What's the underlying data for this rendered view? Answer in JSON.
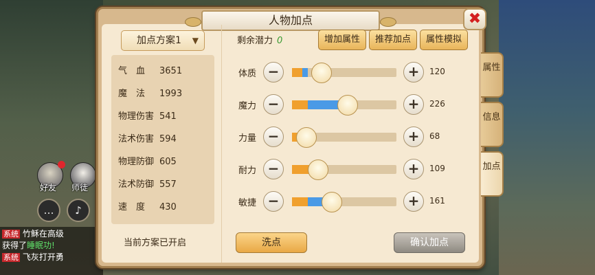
{
  "window": {
    "title": "人物加点"
  },
  "close": {
    "label": "✖"
  },
  "scheme": {
    "selected": "加点方案1",
    "status": "当前方案已开启"
  },
  "stats": [
    {
      "name": "气　血",
      "value": "3651"
    },
    {
      "name": "魔　法",
      "value": "1993"
    },
    {
      "name": "物理伤害",
      "value": "541"
    },
    {
      "name": "法术伤害",
      "value": "594"
    },
    {
      "name": "物理防御",
      "value": "605"
    },
    {
      "name": "法术防御",
      "value": "557"
    },
    {
      "name": "速　度",
      "value": "430"
    }
  ],
  "potential": {
    "label": "剩余潜力",
    "value": "0"
  },
  "top_buttons": [
    "增加属性",
    "推荐加点",
    "属性模拟"
  ],
  "attributes": [
    {
      "name": "体质",
      "value": "120",
      "base_fraction": 0.1,
      "added_fraction": 0.05,
      "level": 0.28
    },
    {
      "name": "魔力",
      "value": "226",
      "base_fraction": 0.15,
      "added_fraction": 0.36,
      "level": 0.53
    },
    {
      "name": "力量",
      "value": "68",
      "base_fraction": 0.1,
      "added_fraction": 0.0,
      "level": 0.14
    },
    {
      "name": "耐力",
      "value": "109",
      "base_fraction": 0.23,
      "added_fraction": 0.0,
      "level": 0.25
    },
    {
      "name": "敏捷",
      "value": "161",
      "base_fraction": 0.15,
      "added_fraction": 0.18,
      "level": 0.38
    }
  ],
  "actions": {
    "wash": "洗点",
    "confirm": "确认加点"
  },
  "side_tabs": [
    {
      "label": "属性",
      "active": false
    },
    {
      "label": "信息",
      "active": false
    },
    {
      "label": "加点",
      "active": true
    }
  ],
  "social": {
    "friends": "好友",
    "master": "师徒"
  },
  "chat": {
    "lines": [
      {
        "tag": "系统",
        "text": "竹稣在高级"
      },
      {
        "tag": "",
        "text": "获得了",
        "highlight": "睡眠功!"
      },
      {
        "tag": "系统",
        "text": "飞灰打开勇"
      }
    ]
  },
  "colors": {
    "accent": "#e9b55a",
    "blue_fill": "#4a9ae6",
    "orange_fill": "#f0a02e",
    "close_x": "#d32020"
  }
}
